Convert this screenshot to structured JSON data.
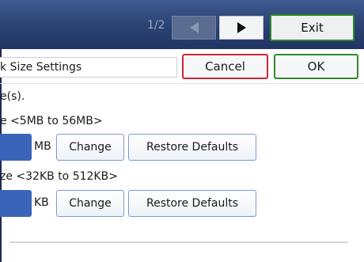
{
  "header": {
    "page_indicator": "1/2",
    "prev_icon": "triangle-left-icon",
    "next_icon": "triangle-right-icon",
    "exit_label": "Exit"
  },
  "title_bar": {
    "title": "k Size Settings",
    "cancel_label": "Cancel",
    "ok_label": "OK"
  },
  "instruction": "e(s).",
  "settings": [
    {
      "range_label": "e <5MB to 56MB>",
      "unit": "MB",
      "change_label": "Change",
      "restore_label": "Restore Defaults"
    },
    {
      "range_label": "ze <32KB to 512KB>",
      "unit": "KB",
      "change_label": "Change",
      "restore_label": "Restore Defaults"
    }
  ],
  "colors": {
    "header_bg": "#2d4576",
    "accent_blue": "#3a64b8",
    "ok_border": "#2e8a2a",
    "cancel_border": "#c8283a"
  }
}
